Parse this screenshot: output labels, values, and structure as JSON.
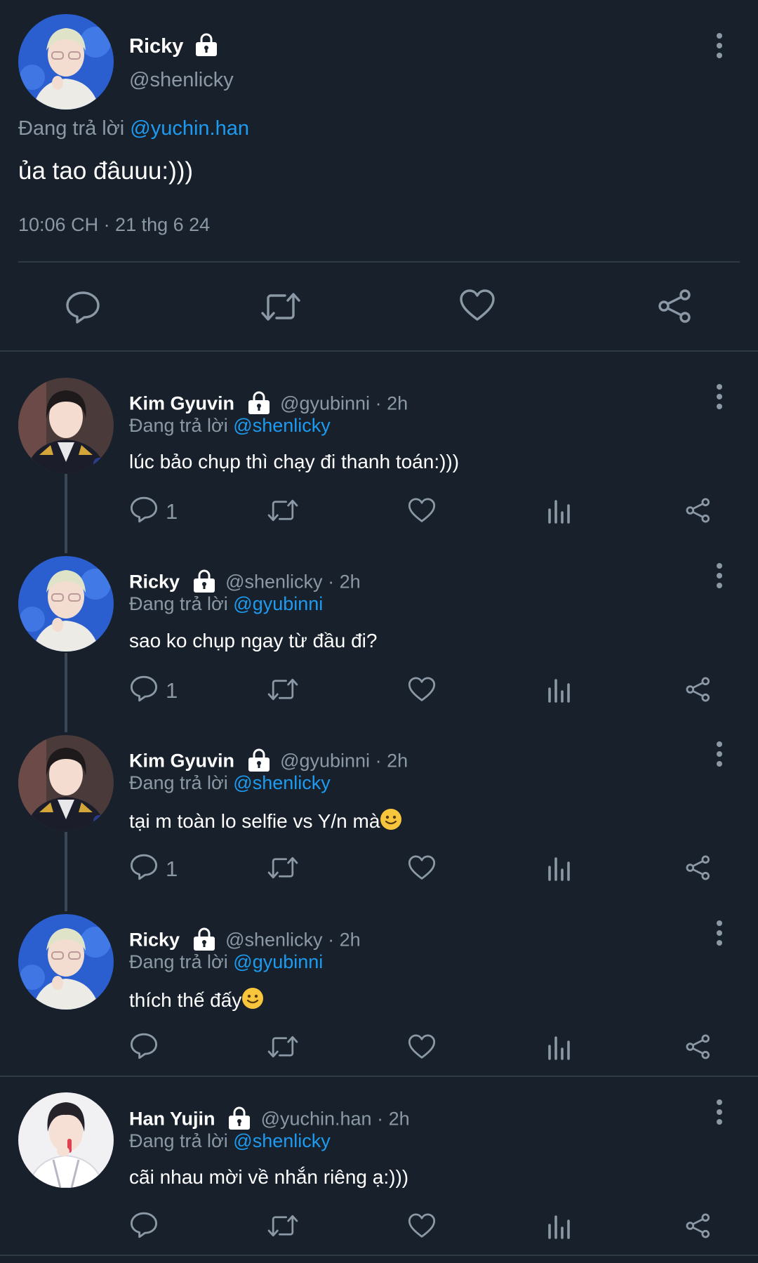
{
  "main_post": {
    "name": "Ricky",
    "handle": "@shenlicky",
    "replying_prefix": "Đang trả lời",
    "replying_to": "@yuchin.han",
    "text": "ủa tao đâuuu:)))",
    "timestamp": "10:06 CH · 21 thg 6 24",
    "actions": [
      "reply-icon",
      "retweet-icon",
      "like-icon",
      "share-icon"
    ]
  },
  "replies": [
    {
      "name": "Kim Gyuvin",
      "handle": "@gyubinni",
      "sep": "·",
      "time": "2h",
      "replying_prefix": "Đang trả lời",
      "replying_to": "@shenlicky",
      "text": "lúc bảo chụp thì chạy đi thanh toán:)))",
      "reply_count": "1"
    },
    {
      "name": "Ricky",
      "handle": "@shenlicky",
      "sep": "·",
      "time": "2h",
      "replying_prefix": "Đang trả lời",
      "replying_to": "@gyubinni",
      "text": "sao ko chụp ngay từ đầu đi?",
      "reply_count": "1"
    },
    {
      "name": "Kim Gyuvin",
      "handle": "@gyubinni",
      "sep": "·",
      "time": "2h",
      "replying_prefix": "Đang trả lời",
      "replying_to": "@shenlicky",
      "text": "tại m toàn lo selfie vs Y/n mà",
      "reply_count": "1"
    },
    {
      "name": "Ricky",
      "handle": "@shenlicky",
      "sep": "·",
      "time": "2h",
      "replying_prefix": "Đang trả lời",
      "replying_to": "@gyubinni",
      "text": "thích thế đấy",
      "reply_count": ""
    },
    {
      "name": "Han Yujin",
      "handle": "@yuchin.han",
      "sep": "·",
      "time": "2h",
      "replying_prefix": "Đang trả lời",
      "replying_to": "@shenlicky",
      "text": "cãi nhau mời về nhắn riêng ạ:)))",
      "reply_count": ""
    }
  ],
  "colors": {
    "background": "#17202b",
    "link": "#1d9bf0",
    "muted": "#8b98a5",
    "divider": "#2f3a47"
  }
}
